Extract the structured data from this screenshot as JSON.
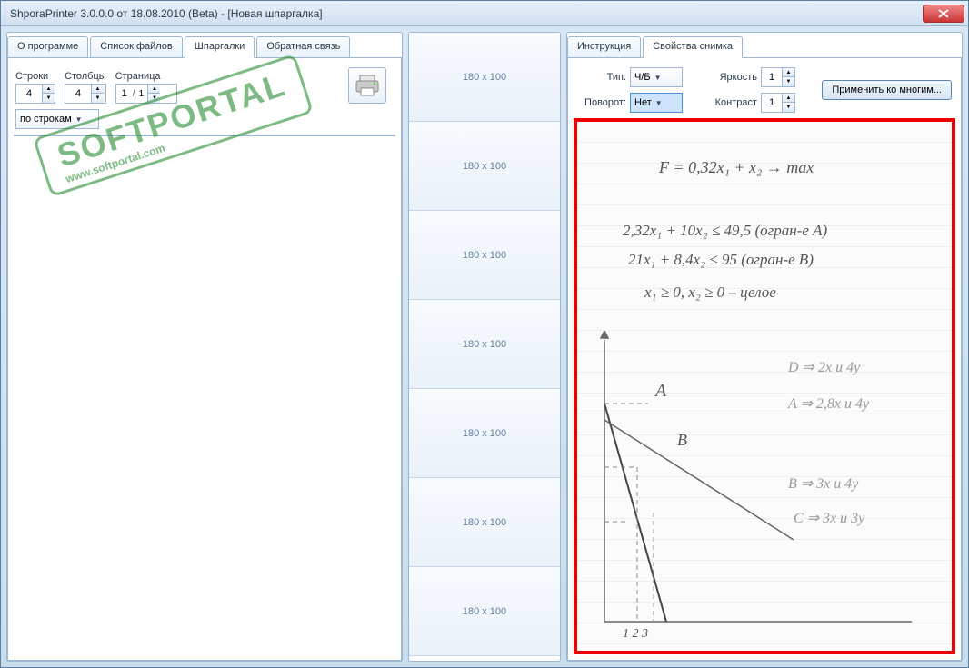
{
  "window": {
    "title": "ShporaPrinter 3.0.0.0 от 18.08.2010 (Beta) - [Новая шпаргалка]"
  },
  "left_tabs": [
    {
      "label": "О программе"
    },
    {
      "label": "Список файлов"
    },
    {
      "label": "Шпаргалки"
    },
    {
      "label": "Обратная связь"
    }
  ],
  "left_tabs_active": 2,
  "controls": {
    "rows_label": "Строки",
    "rows_value": "4",
    "cols_label": "Столбцы",
    "cols_value": "4",
    "page_label": "Страница",
    "page_value": "1",
    "page_max": "1",
    "page_sep": " / ",
    "order_value": "по строкам"
  },
  "mid_slots": [
    "180 x 100",
    "180 x 100",
    "180 x 100",
    "180 x 100",
    "180 x 100",
    "180 x 100",
    "180 x 100"
  ],
  "right_tabs": [
    {
      "label": "Инструкция"
    },
    {
      "label": "Свойства снимка"
    }
  ],
  "right_tabs_active": 1,
  "right_controls": {
    "type_label": "Тип:",
    "type_value": "Ч/Б",
    "rotate_label": "Поворот:",
    "rotate_value": "Нет",
    "brightness_label": "Яркость",
    "brightness_value": "1",
    "contrast_label": "Контраст",
    "contrast_value": "1",
    "apply_label": "Применить ко многим..."
  },
  "preview_notes": {
    "eq1": "F = 0,32x₁ + x₂ → max",
    "eq2": "2,32x₁ + 10x₂ ≤ 49,5 (огран-е A)",
    "eq3": "21x₁ + 8,4x₂ ≤ 95 (огран-е B)",
    "eq4": "x₁ ≥ 0, x₂ ≥ 0 – целое",
    "pA": "A",
    "pB": "B",
    "n1": "D ⇒ 2x и 4y",
    "n2": "A ⇒ 2,8x и 4y",
    "n3": "B ⇒ 3x и 4y",
    "n4": "C ⇒ 3x и 3y",
    "ax12": "1 2 3"
  },
  "stamp": {
    "main": "SOFTPORTAL",
    "sub": "www.softportal.com"
  }
}
